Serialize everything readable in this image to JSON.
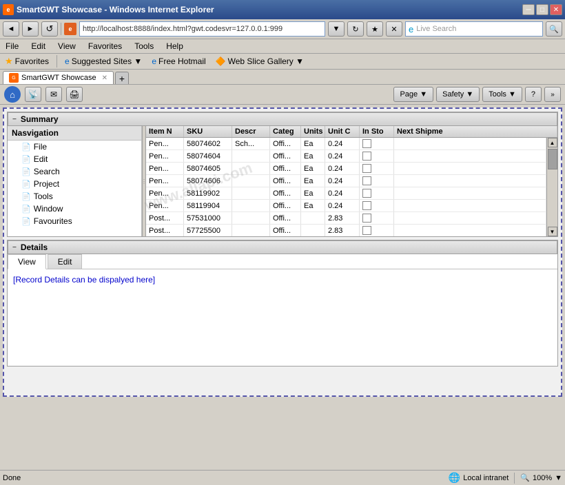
{
  "window": {
    "title": "SmartGWT Showcase - Windows Internet Explorer",
    "icon": "IE"
  },
  "titlebar": {
    "controls": {
      "minimize": "─",
      "restore": "□",
      "close": "✕"
    }
  },
  "addressbar": {
    "back_label": "◄",
    "forward_label": "►",
    "refresh_label": "↺",
    "stop_label": "✕",
    "url": "http://localhost:8888/index.html?gwt.codesvr=127.0.0.1:999",
    "go_label": "→",
    "search_placeholder": "Live Search"
  },
  "menubar": {
    "items": [
      "File",
      "Edit",
      "View",
      "Favorites",
      "Tools",
      "Help"
    ]
  },
  "favoritesbar": {
    "favorites_label": "Favorites",
    "suggested_sites": "Suggested Sites ▼",
    "free_hotmail": "Free Hotmail",
    "web_slice_gallery": "Web Slice Gallery ▼"
  },
  "tabbar": {
    "tabs": [
      {
        "label": "SmartGWT Showcase",
        "active": true
      }
    ],
    "new_tab": "+"
  },
  "toolbar": {
    "page_label": "Page ▼",
    "safety_label": "Safety ▼",
    "tools_label": "Tools ▼",
    "help_label": "?"
  },
  "summary": {
    "header_label": "Summary",
    "toggle": "−",
    "nav": {
      "header": "Nasvigation",
      "items": [
        {
          "label": "File"
        },
        {
          "label": "Edit"
        },
        {
          "label": "Search"
        },
        {
          "label": "Project"
        },
        {
          "label": "Tools"
        },
        {
          "label": "Window"
        },
        {
          "label": "Favourites"
        }
      ]
    },
    "grid": {
      "columns": [
        "Item N",
        "SKU",
        "Descr",
        "Categ",
        "Units",
        "Unit C",
        "In Sto",
        "Next Shipme"
      ],
      "rows": [
        {
          "item_num": "Pen...",
          "sku": "58074602",
          "desc": "Sch...",
          "categ": "Offi...",
          "units": "Ea",
          "unit_cost": "0.24",
          "in_stock": false,
          "next_ship": ""
        },
        {
          "item_num": "Pen...",
          "sku": "58074604",
          "desc": "",
          "categ": "Offi...",
          "units": "Ea",
          "unit_cost": "0.24",
          "in_stock": false,
          "next_ship": ""
        },
        {
          "item_num": "Pen...",
          "sku": "58074605",
          "desc": "",
          "categ": "Offi...",
          "units": "Ea",
          "unit_cost": "0.24",
          "in_stock": false,
          "next_ship": ""
        },
        {
          "item_num": "Pen...",
          "sku": "58074606",
          "desc": "",
          "categ": "Offi...",
          "units": "Ea",
          "unit_cost": "0.24",
          "in_stock": false,
          "next_ship": ""
        },
        {
          "item_num": "Pen...",
          "sku": "58119902",
          "desc": "",
          "categ": "Offi...",
          "units": "Ea",
          "unit_cost": "0.24",
          "in_stock": false,
          "next_ship": ""
        },
        {
          "item_num": "Pen...",
          "sku": "58119904",
          "desc": "",
          "categ": "Offi...",
          "units": "Ea",
          "unit_cost": "0.24",
          "in_stock": false,
          "next_ship": ""
        },
        {
          "item_num": "Post...",
          "sku": "57531000",
          "desc": "",
          "categ": "Offi...",
          "units": "",
          "unit_cost": "2.83",
          "in_stock": false,
          "next_ship": ""
        },
        {
          "item_num": "Post...",
          "sku": "57725500",
          "desc": "",
          "categ": "Offi...",
          "units": "",
          "unit_cost": "2.83",
          "in_stock": false,
          "next_ship": ""
        }
      ]
    }
  },
  "details": {
    "header_label": "Details",
    "toggle": "−",
    "tabs": [
      "View",
      "Edit"
    ],
    "active_tab": "View",
    "content": "[Record Details can be dispalyed here]"
  },
  "statusbar": {
    "status": "Done",
    "zone": "Local intranet",
    "zoom": "100%"
  },
  "watermark": "www.allapi.com"
}
